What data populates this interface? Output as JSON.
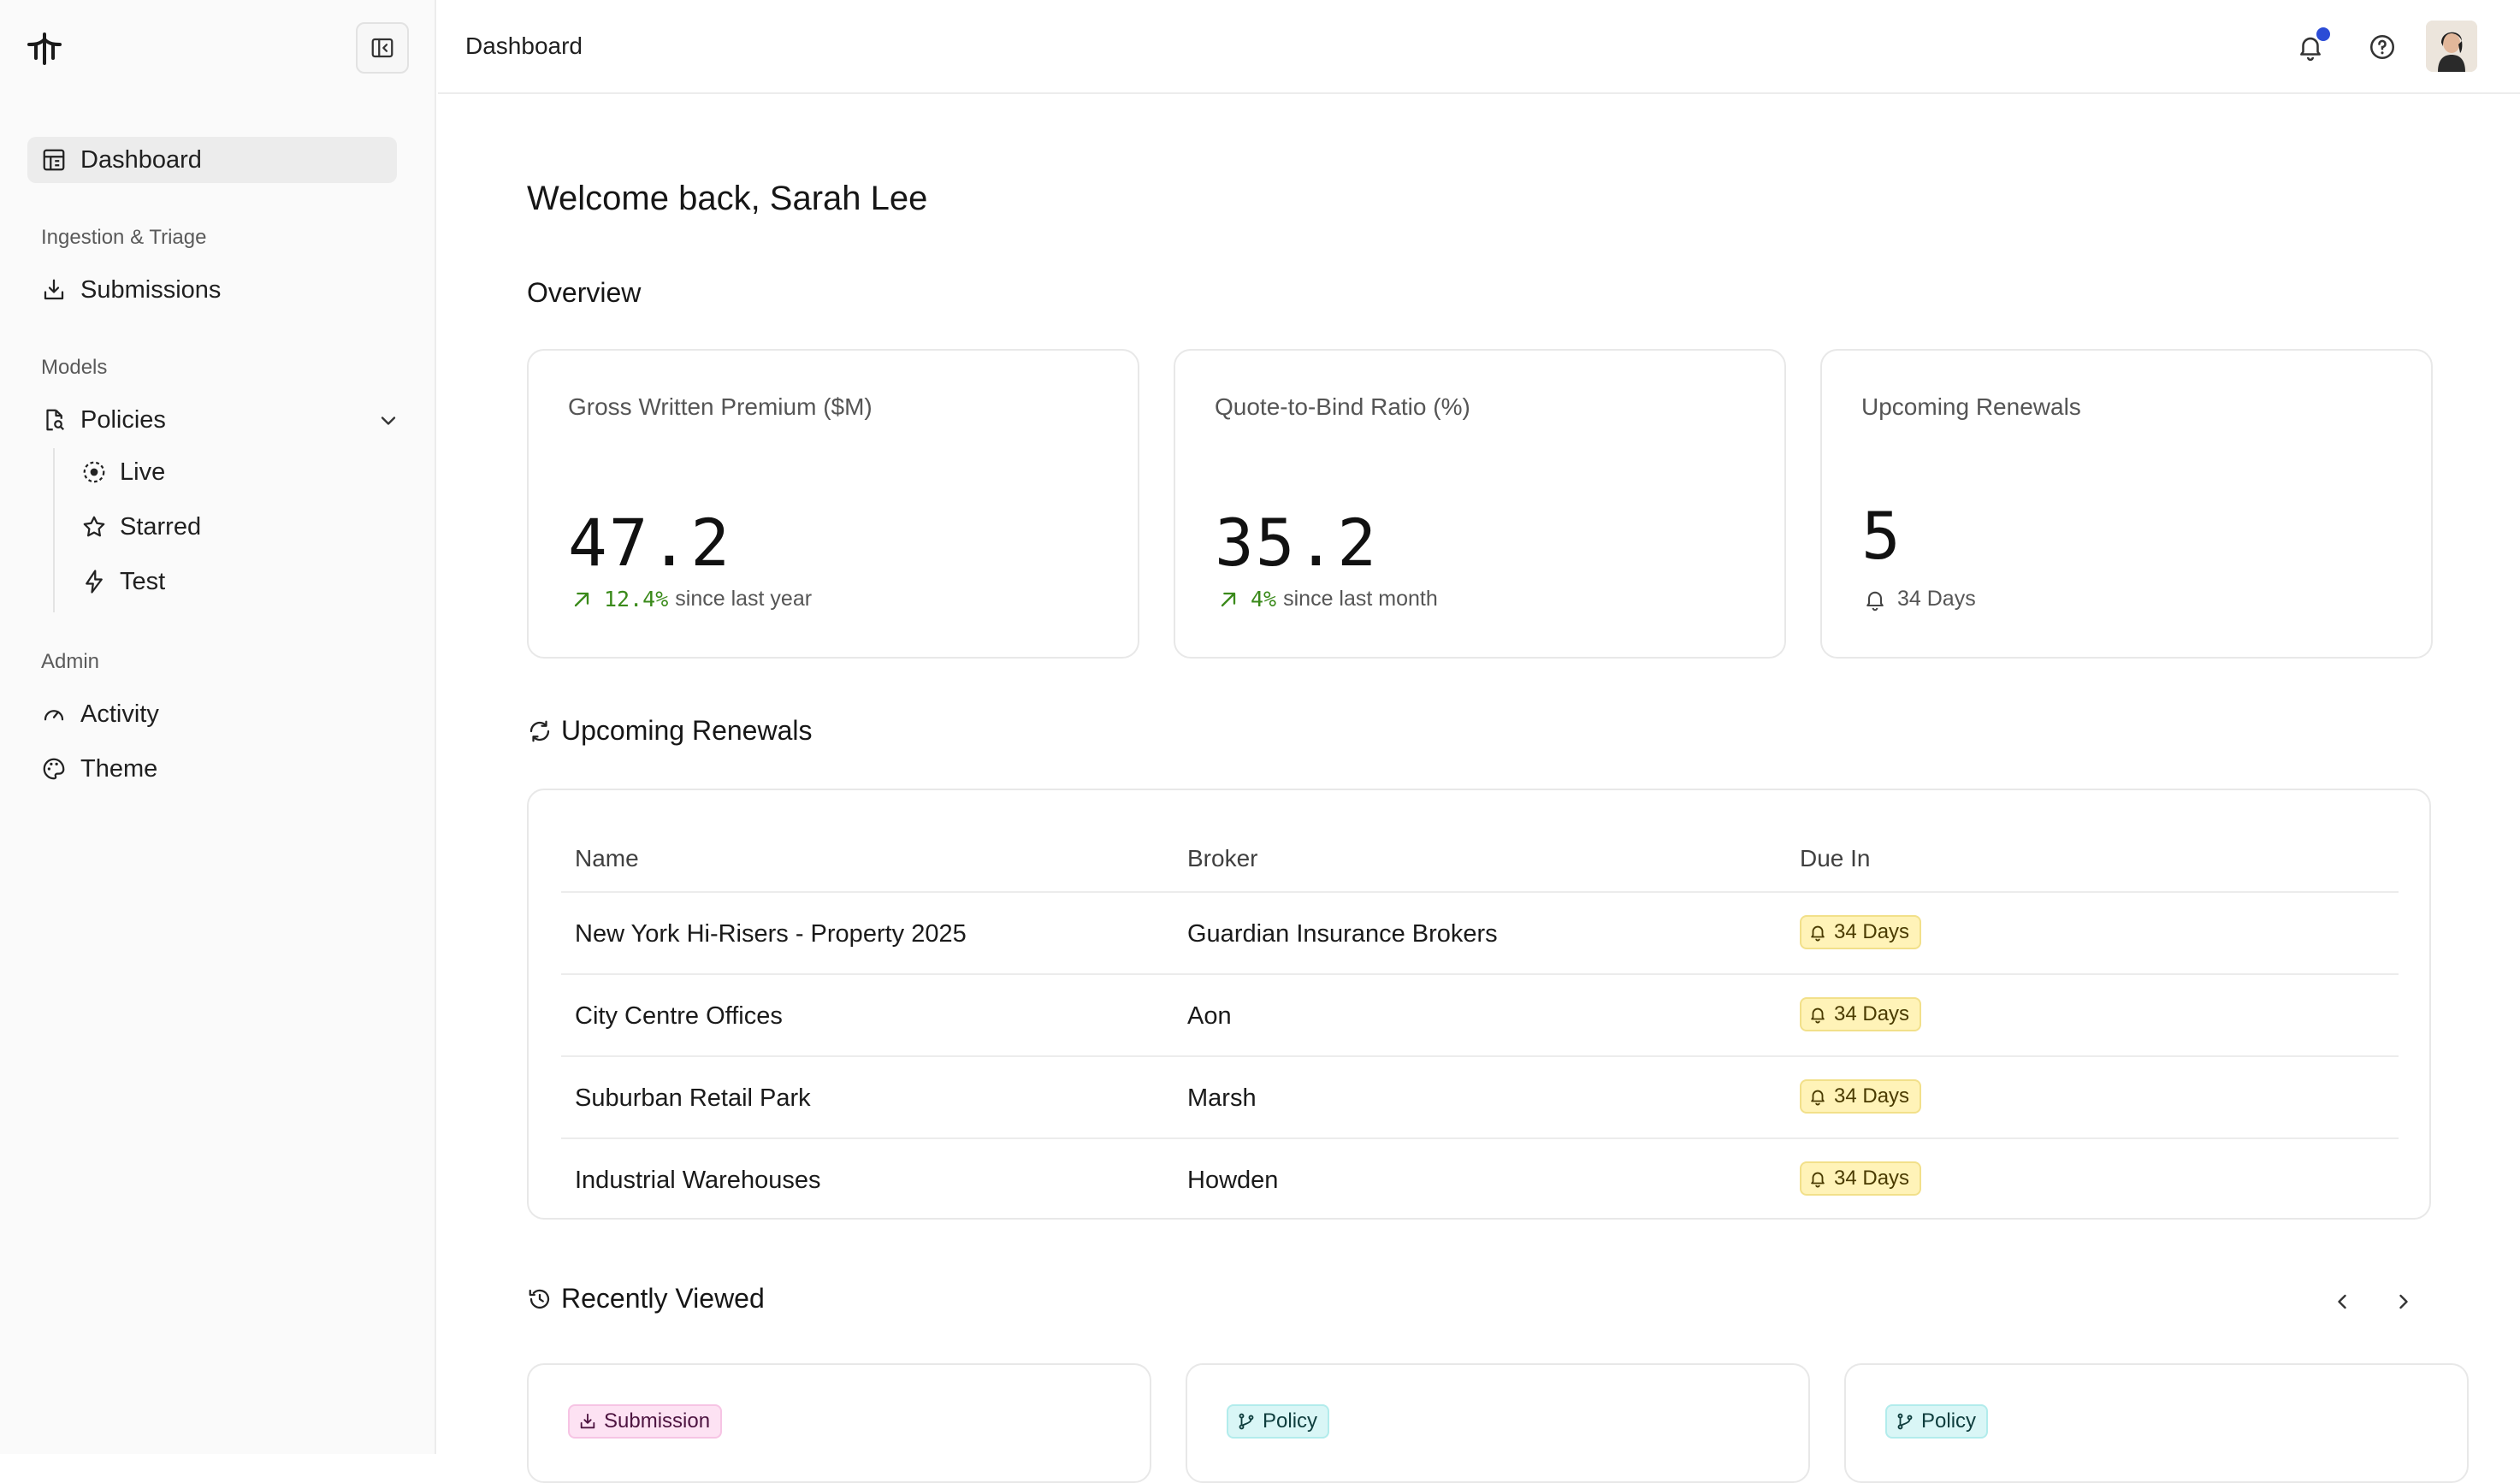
{
  "sidebar": {
    "nav_dashboard": "Dashboard",
    "section_ingestion": "Ingestion & Triage",
    "nav_submissions": "Submissions",
    "section_models": "Models",
    "nav_policies": "Policies",
    "sub_live": "Live",
    "sub_starred": "Starred",
    "sub_test": "Test",
    "section_admin": "Admin",
    "nav_activity": "Activity",
    "nav_theme": "Theme"
  },
  "topbar": {
    "breadcrumb": "Dashboard",
    "notification_color": "#2b4cd6"
  },
  "main": {
    "welcome": "Welcome back, Sarah Lee",
    "overview_title": "Overview",
    "cards": [
      {
        "label": "Gross Written Premium ($M)",
        "value": "47.2",
        "delta": "12.4%",
        "delta_text": "since last year"
      },
      {
        "label": "Quote-to-Bind Ratio (%)",
        "value": "35.2",
        "delta": "4%",
        "delta_text": "since last month"
      },
      {
        "label": "Upcoming Renewals",
        "value": "5",
        "note": "34 Days"
      }
    ],
    "renewals_title": "Upcoming Renewals",
    "renewals_columns": [
      "Name",
      "Broker",
      "Due In"
    ],
    "renewals_rows": [
      {
        "name": "New York Hi-Risers - Property 2025",
        "broker": "Guardian Insurance Brokers",
        "due": "34 Days"
      },
      {
        "name": "City Centre Offices",
        "broker": "Aon",
        "due": "34 Days"
      },
      {
        "name": "Suburban Retail Park",
        "broker": "Marsh",
        "due": "34 Days"
      },
      {
        "name": "Industrial Warehouses",
        "broker": "Howden",
        "due": "34 Days"
      }
    ],
    "recent_title": "Recently Viewed",
    "recent_tags": [
      "Submission",
      "Policy",
      "Policy"
    ]
  },
  "colors": {
    "positive": "#3a8a1a",
    "badge_bg": "#fff3b8",
    "submission_tag": "#fde2f3",
    "policy_tag": "#d9f6f6"
  }
}
